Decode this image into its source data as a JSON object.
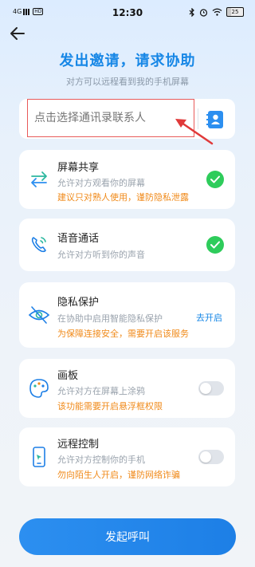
{
  "status_bar": {
    "network": "4G",
    "hd": "HD",
    "time": "12:30",
    "battery": "25"
  },
  "header": {
    "title": "发出邀请，请求协助",
    "subtitle": "对方可以远程看到我的手机屏幕"
  },
  "contact": {
    "placeholder": "点击选择通讯录联系人"
  },
  "cards": [
    {
      "name": "屏幕共享",
      "desc": "允许对方观看你的屏幕",
      "warn": "建议只对熟人使用，谨防隐私泄露",
      "state": "checked"
    },
    {
      "name": "语音通话",
      "desc": "允许对方听到你的声音",
      "state": "checked"
    },
    {
      "name": "隐私保护",
      "desc": "在协助中启用智能隐私保护",
      "warn": "为保障连接安全，需要开启该服务",
      "action": "去开启"
    },
    {
      "name": "画板",
      "desc": "允许对方在屏幕上涂鸦",
      "warn": "该功能需要开启悬浮框权限",
      "state": "off"
    },
    {
      "name": "远程控制",
      "desc": "允许对方控制你的手机",
      "warn": "勿向陌生人开启，谨防网络诈骗",
      "state": "off"
    }
  ],
  "call_button": "发起呼叫",
  "colors": {
    "accent": "#1787e6",
    "warning": "#f08a1a",
    "success": "#2ecc5b"
  }
}
